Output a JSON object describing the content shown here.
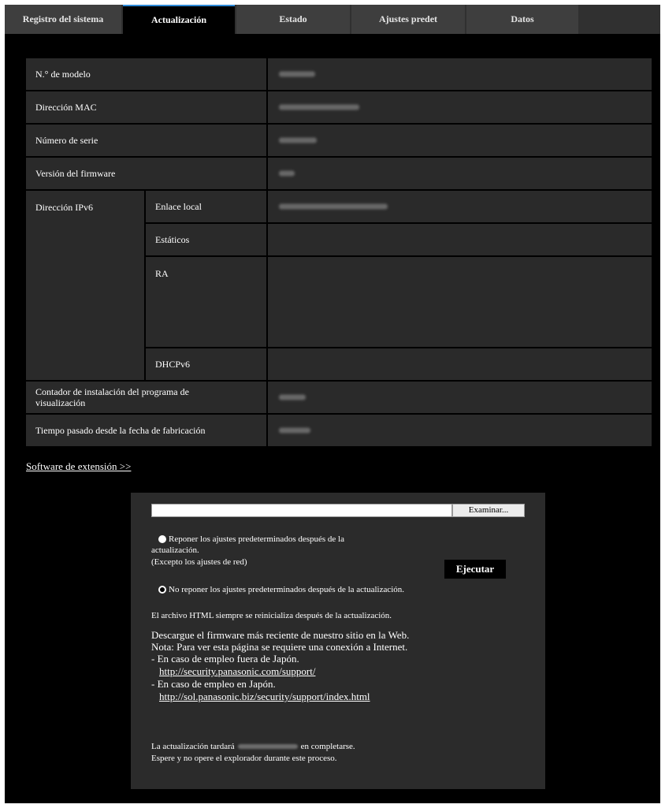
{
  "tabs": [
    {
      "label": "Registro del sistema",
      "active": false
    },
    {
      "label": "Actualización",
      "active": true
    },
    {
      "label": "Estado",
      "active": false
    },
    {
      "label": "Ajustes predet",
      "active": false
    },
    {
      "label": "Datos",
      "active": false
    }
  ],
  "info": {
    "model_label": "N.° de modelo",
    "mac_label": "Dirección MAC",
    "serial_label": "Número de serie",
    "firmware_label": "Versión del firmware",
    "ipv6_label": "Dirección IPv6",
    "link_local_label": "Enlace local",
    "static_label": "Estáticos",
    "ra_label": "RA",
    "dhcpv6_label": "DHCPv6",
    "viewer_counter_label": "Contador de instalación del programa de visualización",
    "elapsed_time_label": "Tiempo pasado desde la fecha de fabricación"
  },
  "extension_link": "Software de extensión >>",
  "upgrade": {
    "browse_label": "Examinar...",
    "reset_option_line1": "Reponer los ajustes predeterminados después de la",
    "reset_option_line2": "actualización.",
    "reset_option_line3": "(Excepto los ajustes de red)",
    "noreset_option": "No reponer los ajustes predeterminados después de la actualización.",
    "execute_label": "Ejecutar",
    "html_note": "El archivo HTML siempre se reinicializa después de la actualización.",
    "download_line1": "Descargue el firmware más reciente de nuestro sitio en la Web.",
    "download_line2": "Nota: Para ver esta página se requiere una conexión a Internet.",
    "download_line3": "- En caso de empleo fuera de Japón.",
    "url_outside": "http://security.panasonic.com/support/",
    "download_line4": "- En caso de empleo en Japón.",
    "url_japan": "http://sol.panasonic.biz/security/support/index.html",
    "time_prefix": "La actualización tardará",
    "time_suffix": "en completarse.",
    "wait_note": "Espere y no opere el explorador durante este proceso."
  }
}
